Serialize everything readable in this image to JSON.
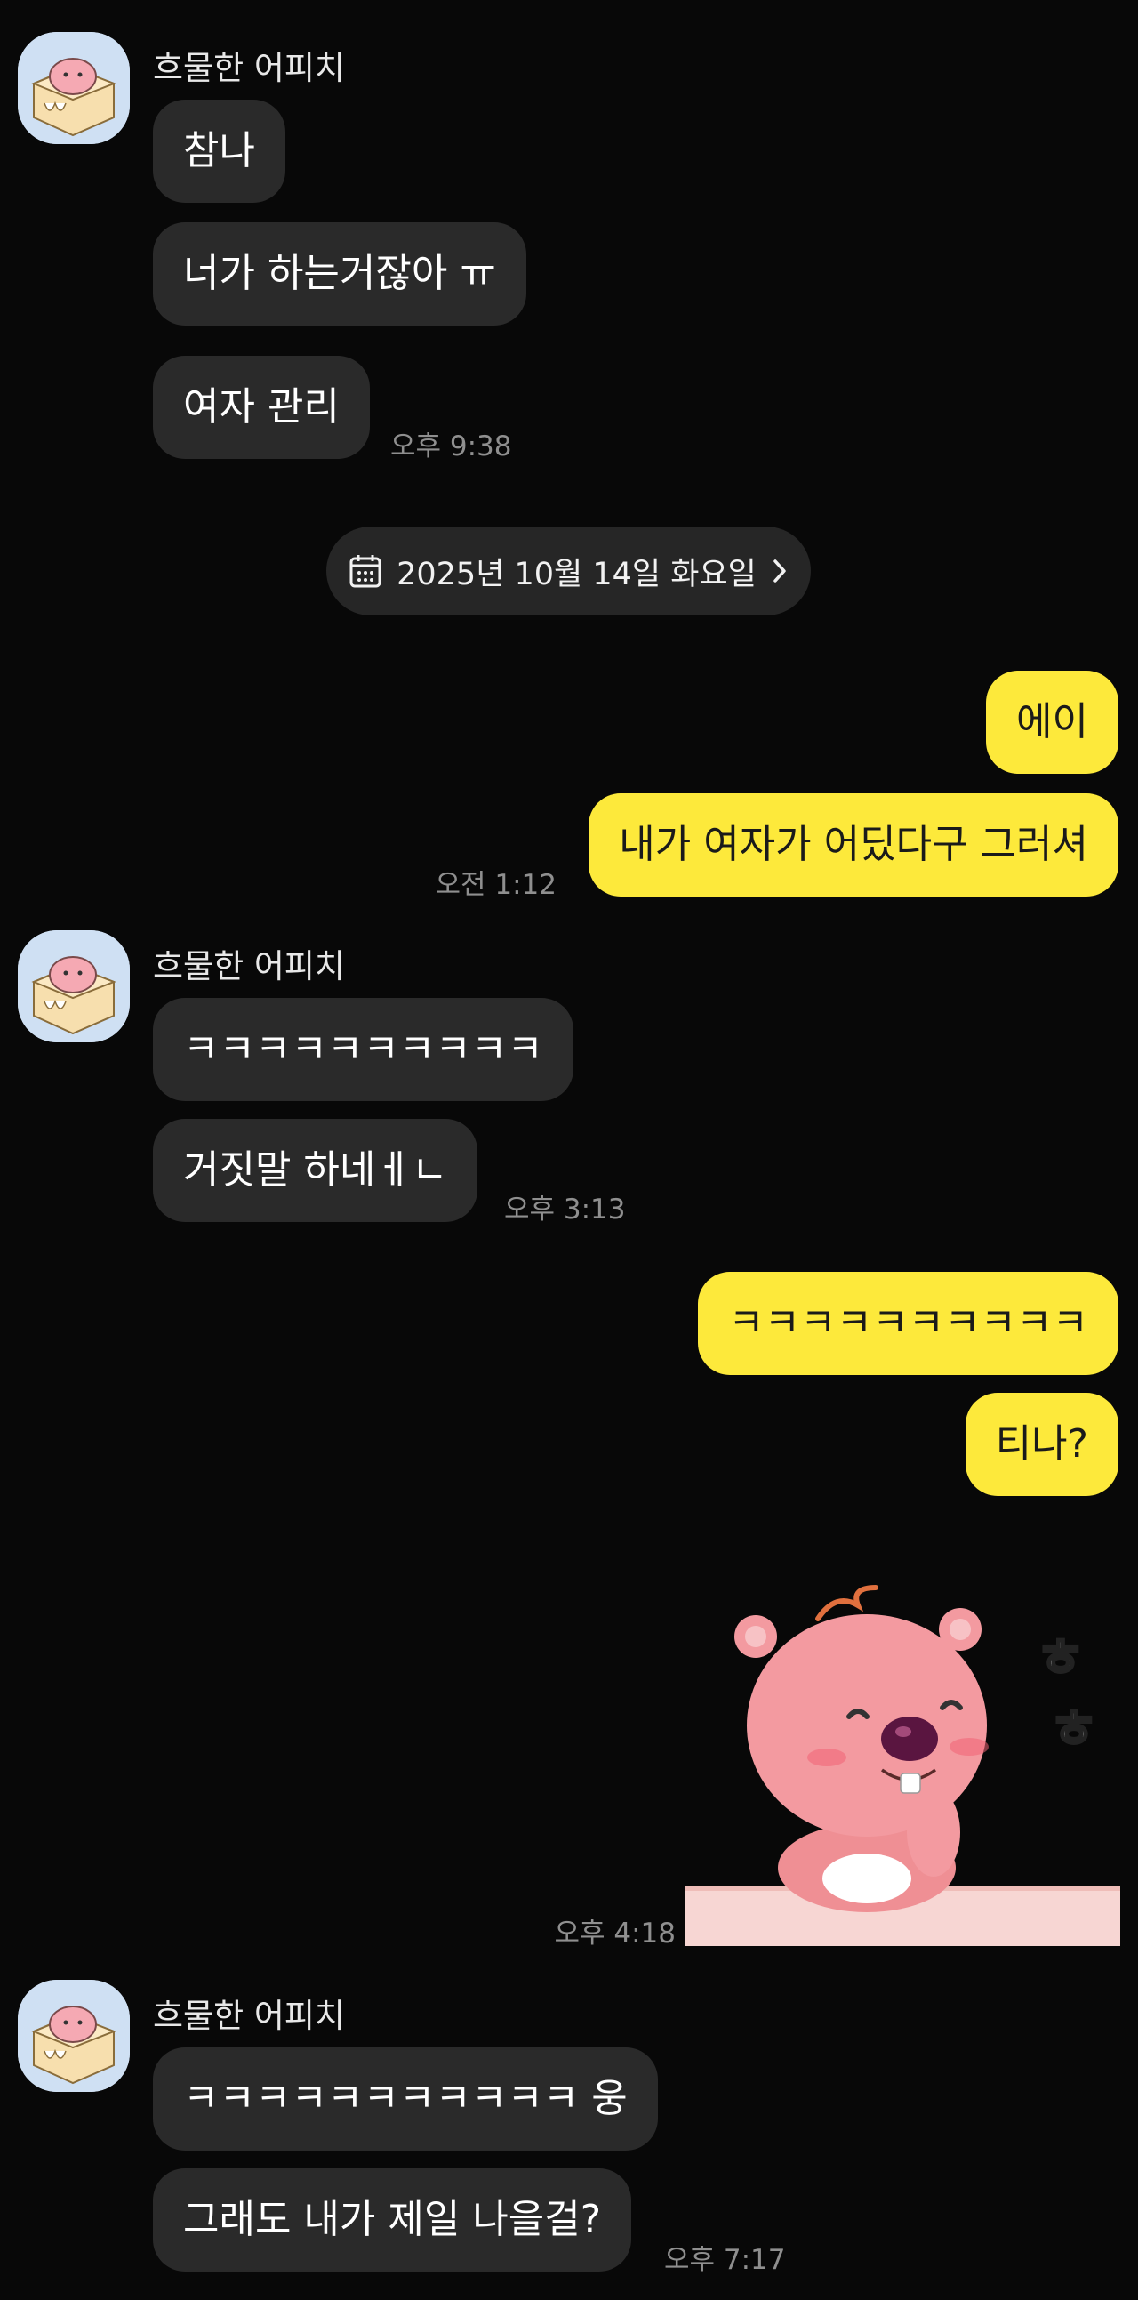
{
  "chat": {
    "sender_name": "흐물한 어피치",
    "date_divider": "2025년 10월 14일 화요일",
    "groups": [
      {
        "type": "in",
        "messages": [
          "참나",
          "너가 하는거잖아 ㅠ",
          "여자 관리"
        ],
        "time": "오후 9:38"
      },
      {
        "type": "out",
        "messages": [
          "에이",
          "내가 여자가 어딨다구 그러셔"
        ],
        "time": "오전 1:12"
      },
      {
        "type": "in",
        "messages": [
          "ㅋㅋㅋㅋㅋㅋㅋㅋㅋㅋ",
          "거짓말 하네ㅔㄴ"
        ],
        "time": "오후 3:13"
      },
      {
        "type": "out",
        "messages": [
          "ㅋㅋㅋㅋㅋㅋㅋㅋㅋㅋ",
          "티나?"
        ],
        "time": ""
      },
      {
        "type": "out-sticker",
        "sticker": "loopy-beaver-laughing-sticker",
        "sticker_text": "ㅎㅎ",
        "time": "오후 4:18"
      },
      {
        "type": "in",
        "messages": [
          "ㅋㅋㅋㅋㅋㅋㅋㅋㅋㅋㅋ 웅",
          "그래도 내가 제일 나을걸?"
        ],
        "time": "오후 7:17"
      }
    ]
  },
  "colors": {
    "background": "#080808",
    "incoming_bubble": "#2a2a2a",
    "outgoing_bubble": "#fde93b",
    "time_text": "#8f8f8f"
  },
  "icons": {
    "date": "calendar-icon",
    "date_arrow": "chevron-right-icon",
    "avatar": "apeach-avatar"
  }
}
